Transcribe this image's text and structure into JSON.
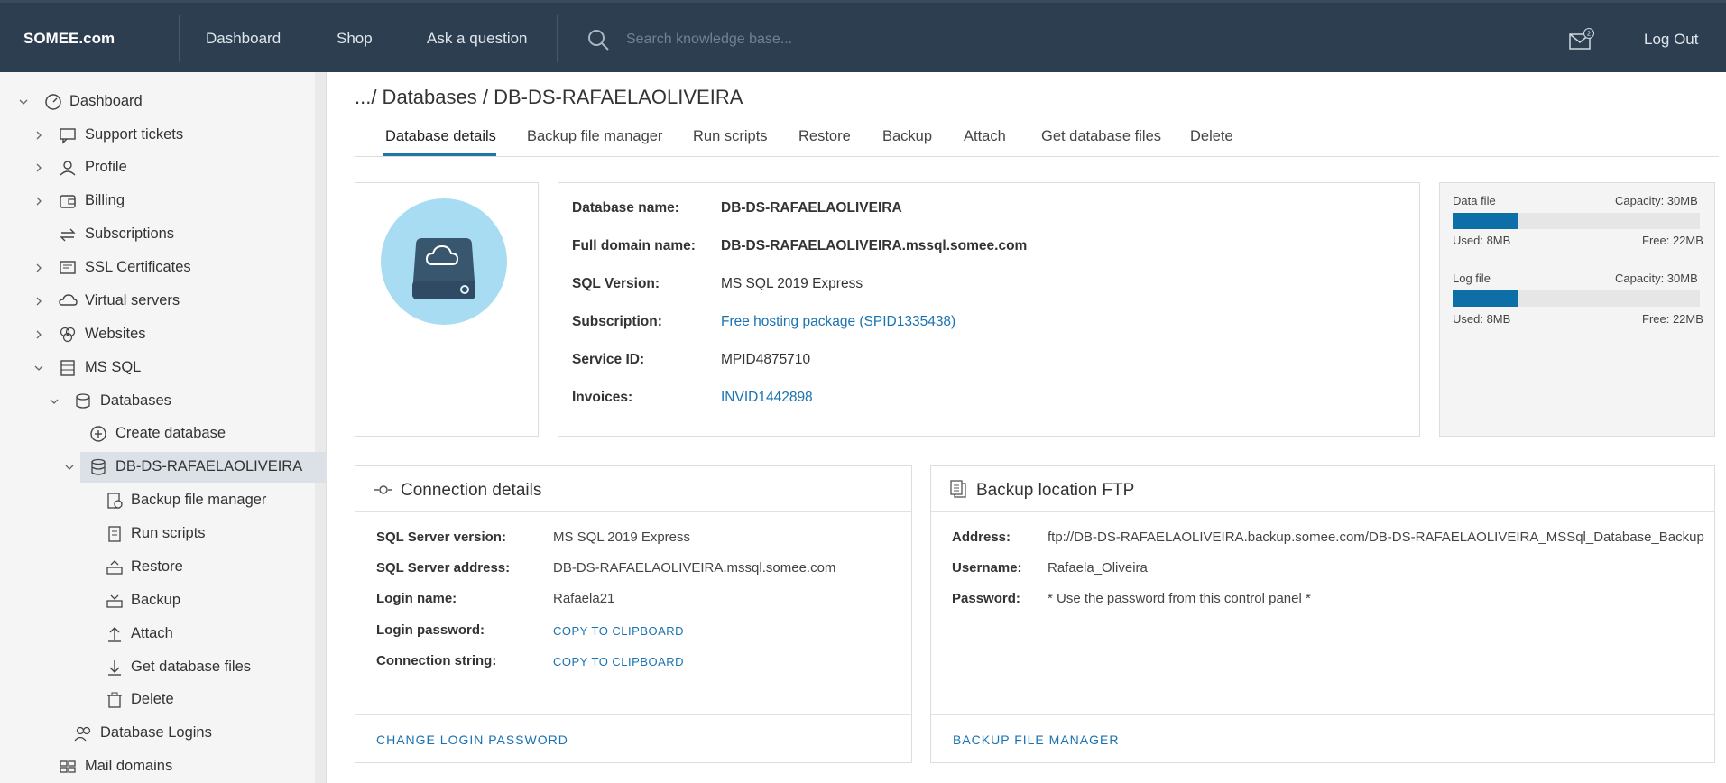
{
  "topbar": {
    "logo": "SOMEE.com",
    "nav": [
      "Dashboard",
      "Shop",
      "Ask a question"
    ],
    "search_placeholder": "Search knowledge base...",
    "mail_badge": "2",
    "logout": "Log Out"
  },
  "sidebar": {
    "items": [
      {
        "label": "Dashboard",
        "icon": "dashboard-icon"
      },
      {
        "label": "Support tickets",
        "icon": "chat-icon"
      },
      {
        "label": "Profile",
        "icon": "user-icon"
      },
      {
        "label": "Billing",
        "icon": "wallet-icon"
      },
      {
        "label": "Subscriptions",
        "icon": "refresh-icon"
      },
      {
        "label": "SSL Certificates",
        "icon": "certificate-icon"
      },
      {
        "label": "Virtual servers",
        "icon": "cloud-server-icon"
      },
      {
        "label": "Websites",
        "icon": "websites-icon"
      },
      {
        "label": "MS SQL",
        "icon": "sql-server-icon"
      },
      {
        "label": "Databases",
        "icon": "databases-icon"
      },
      {
        "label": "Create database",
        "icon": "plus-circle-icon"
      },
      {
        "label": "DB-DS-RAFAELAOLIVEIRA",
        "icon": "database-icon"
      },
      {
        "label": "Backup file manager",
        "icon": "backup-file-icon"
      },
      {
        "label": "Run scripts",
        "icon": "script-icon"
      },
      {
        "label": "Restore",
        "icon": "restore-icon"
      },
      {
        "label": "Backup",
        "icon": "backup-icon"
      },
      {
        "label": "Attach",
        "icon": "upload-icon"
      },
      {
        "label": "Get database files",
        "icon": "download-icon"
      },
      {
        "label": "Delete",
        "icon": "trash-icon"
      },
      {
        "label": "Database Logins",
        "icon": "users-icon"
      },
      {
        "label": "Mail domains",
        "icon": "grid-icon"
      }
    ]
  },
  "breadcrumb": ".../ Databases / DB-DS-RAFAELAOLIVEIRA",
  "tabs": [
    "Database details",
    "Backup file manager",
    "Run scripts",
    "Restore",
    "Backup",
    "Attach",
    "Get database files",
    "Delete"
  ],
  "details": {
    "rows": [
      {
        "label": "Database name:",
        "value": "DB-DS-RAFAELAOLIVEIRA"
      },
      {
        "label": "Full domain name:",
        "value": "DB-DS-RAFAELAOLIVEIRA.mssql.somee.com"
      },
      {
        "label": "SQL Version:",
        "value": "MS SQL 2019 Express"
      },
      {
        "label": "Subscription:",
        "value": "Free hosting package (SPID1335438)"
      },
      {
        "label": "Service ID:",
        "value": "MPID4875710"
      },
      {
        "label": "Invoices:",
        "value": "INVID1442898"
      }
    ]
  },
  "usage": {
    "data_file": {
      "title": "Data file",
      "capacity": "Capacity: 30MB",
      "used": "Used: 8MB",
      "free": "Free: 22MB",
      "fraction": 0.267
    },
    "log_file": {
      "title": "Log file",
      "capacity": "Capacity: 30MB",
      "used": "Used: 8MB",
      "free": "Free: 22MB",
      "fraction": 0.267
    }
  },
  "connection": {
    "title": "Connection details",
    "rows": [
      {
        "label": "SQL Server version:",
        "value": "MS SQL 2019 Express"
      },
      {
        "label": "SQL Server address:",
        "value": "DB-DS-RAFAELAOLIVEIRA.mssql.somee.com"
      },
      {
        "label": "Login name:",
        "value": "Rafaela21"
      },
      {
        "label": "Login password:",
        "value": "COPY TO CLIPBOARD"
      },
      {
        "label": "Connection string:",
        "value": "COPY TO CLIPBOARD"
      }
    ],
    "footer": "CHANGE LOGIN PASSWORD"
  },
  "backup_ftp": {
    "title": "Backup location FTP",
    "rows": [
      {
        "label": "Address:",
        "value": "ftp://DB-DS-RAFAELAOLIVEIRA.backup.somee.com/DB-DS-RAFAELAOLIVEIRA_MSSql_Database_Backup"
      },
      {
        "label": "Username:",
        "value": "Rafaela_Oliveira"
      },
      {
        "label": "Password:",
        "value": "* Use the password from this control panel *"
      }
    ],
    "footer": "BACKUP FILE MANAGER"
  },
  "colors": {
    "topbar": "#2c3e50",
    "accent": "#1a72b0",
    "bar_fill": "#0d6ea8"
  }
}
